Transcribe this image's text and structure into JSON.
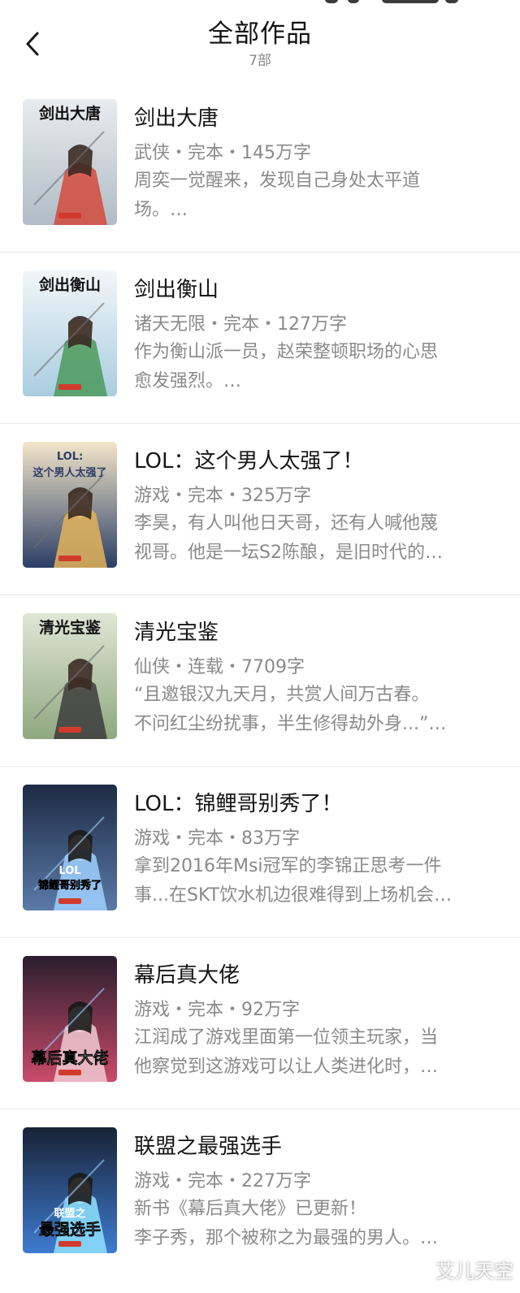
{
  "header": {
    "title": "全部作品",
    "subtitle": "7部"
  },
  "books": [
    {
      "title": "剑出大唐",
      "meta": "武侠・完本・145万字",
      "desc": [
        "周奕一觉醒来，发现自己身处太平道",
        "场。…"
      ],
      "cover_text": "剑出大唐",
      "cover_sub": "",
      "cover_colors": [
        "#e8ecef",
        "#b0bcc6",
        "#d24a3c"
      ]
    },
    {
      "title": "剑出衡山",
      "meta": "诸天无限・完本・127万字",
      "desc": [
        "作为衡山派一员，赵荣整顿职场的心思",
        "愈发强烈。…"
      ],
      "cover_text": "剑出衡山",
      "cover_sub": "",
      "cover_colors": [
        "#f2f6f8",
        "#a9cde0",
        "#4b9a5c"
      ]
    },
    {
      "title": "LOL：这个男人太强了！",
      "meta": "游戏・完本・325万字",
      "desc": [
        "李昊，有人叫他日天哥，还有人喊他蔑",
        "视哥。他是一坛S2陈酿，是旧时代的…"
      ],
      "cover_text": "这个男人太强了",
      "cover_sub": "LOL:",
      "cover_colors": [
        "#f3e6c9",
        "#2b3e66",
        "#e3b35a"
      ]
    },
    {
      "title": "清光宝鉴",
      "meta": "仙侠・连载・7709字",
      "desc": [
        "“且邀银汉九天月，共赏人间万古春。",
        "不问红尘纷扰事，半生修得劫外身...”…"
      ],
      "cover_text": "清光宝鉴",
      "cover_sub": "",
      "cover_colors": [
        "#dfe6d6",
        "#8fa87f",
        "#3c3c3c"
      ]
    },
    {
      "title": "LOL：锦鲤哥别秀了！",
      "meta": "游戏・完本・83万字",
      "desc": [
        "拿到2016年Msi冠军的李锦正思考一件",
        "事...在SKT饮水机边很难得到上场机会…"
      ],
      "cover_text": "锦鲤哥别秀了",
      "cover_sub": "LOL",
      "cover_colors": [
        "#1d2b45",
        "#5b7aa8",
        "#9fd0ff"
      ]
    },
    {
      "title": "幕后真大佬",
      "meta": "游戏・完本・92万字",
      "desc": [
        "江润成了游戏里面第一位领主玩家，当",
        "他察觉到这游戏可以让人类进化时，…"
      ],
      "cover_text": "幕后真大佬",
      "cover_sub": "",
      "cover_colors": [
        "#2a1e2e",
        "#c94b6a",
        "#f0c9d4"
      ]
    },
    {
      "title": "联盟之最强选手",
      "meta": "游戏・完本・227万字",
      "desc": [
        "新书《幕后真大佬》已更新！",
        "李子秀，那个被称之为最强的男人。…"
      ],
      "cover_text": "最强选手",
      "cover_sub": "联盟之",
      "cover_colors": [
        "#182236",
        "#3f7bd0",
        "#8ee0ff"
      ]
    }
  ],
  "watermark": "艾儿天空"
}
